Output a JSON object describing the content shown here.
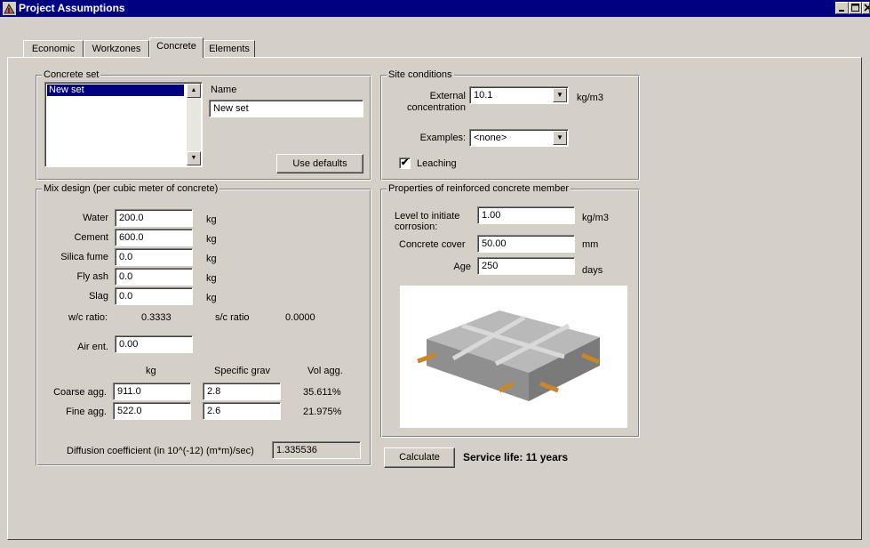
{
  "window": {
    "title": "Project Assumptions"
  },
  "tabs": [
    {
      "label": "Economic",
      "active": false
    },
    {
      "label": "Workzones",
      "active": false
    },
    {
      "label": "Concrete",
      "active": true
    },
    {
      "label": "Elements",
      "active": false
    }
  ],
  "concrete_set": {
    "group_label": "Concrete set",
    "items": [
      "New set"
    ],
    "selected_index": 0,
    "name_label": "Name",
    "name_value": "New set",
    "use_defaults_label": "Use defaults"
  },
  "mix_design": {
    "group_label": "Mix design (per cubic meter of concrete)",
    "rows": [
      {
        "label": "Water",
        "value": "200.0",
        "unit": "kg"
      },
      {
        "label": "Cement",
        "value": "600.0",
        "unit": "kg"
      },
      {
        "label": "Silica fume",
        "value": "0.0",
        "unit": "kg"
      },
      {
        "label": "Fly ash",
        "value": "0.0",
        "unit": "kg"
      },
      {
        "label": "Slag",
        "value": "0.0",
        "unit": "kg"
      }
    ],
    "wc_label": "w/c ratio:",
    "wc_value": "0.3333",
    "sc_label": "s/c ratio",
    "sc_value": "0.0000",
    "air_label": "Air ent.",
    "air_value": "0.00",
    "agg_headers": {
      "kg": "kg",
      "specific_grav": "Specific grav",
      "vol_agg": "Vol agg."
    },
    "aggregates": [
      {
        "label": "Coarse agg.",
        "kg": "911.0",
        "specific_grav": "2.8",
        "vol_agg": "35.611%"
      },
      {
        "label": "Fine agg.",
        "kg": "522.0",
        "specific_grav": "2.6",
        "vol_agg": "21.975%"
      }
    ],
    "diffusion_label": "Diffusion coefficient (in 10^(-12) (m*m)/sec)",
    "diffusion_value": "1.335536"
  },
  "site_conditions": {
    "group_label": "Site conditions",
    "ext_conc_label_1": "External",
    "ext_conc_label_2": "concentration",
    "ext_conc_value": "10.1",
    "ext_conc_unit": "kg/m3",
    "examples_label": "Examples:",
    "examples_value": "<none>",
    "leaching_label": "Leaching",
    "leaching_checked": true
  },
  "properties": {
    "group_label": "Properties of reinforced concrete member",
    "level_label_1": "Level to initiate",
    "level_label_2": "corrosion:",
    "level_value": "1.00",
    "level_unit": "kg/m3",
    "cover_label": "Concrete cover",
    "cover_value": "50.00",
    "cover_unit": "mm",
    "age_label": "Age",
    "age_value": "250",
    "age_unit": "days"
  },
  "calculate_label": "Calculate",
  "service_life_text": "Service life: 11 years",
  "icons": {
    "app": "app-icon",
    "check": "✔"
  },
  "colors": {
    "titlebar": "#000080",
    "face": "#d4d0c8",
    "selection": "#000080"
  }
}
